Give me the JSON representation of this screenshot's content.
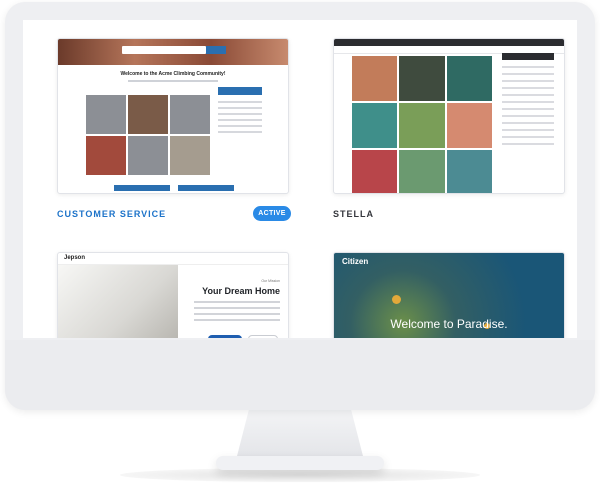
{
  "cards": [
    {
      "label": "CUSTOMER SERVICE",
      "badge": "ACTIVE",
      "preview_title": "Welcome to the Acme Climbing Community!"
    },
    {
      "label": "STELLA"
    },
    {
      "preview_logo": "Jepson",
      "preview_eyebrow": "Our Mission",
      "preview_heading": "Your Dream Home"
    },
    {
      "preview_logo": "Citizen",
      "preview_heading": "Welcome to Paradise."
    }
  ],
  "colors": {
    "accent": "#2a8ae6",
    "active_label": "#1d73c9"
  }
}
